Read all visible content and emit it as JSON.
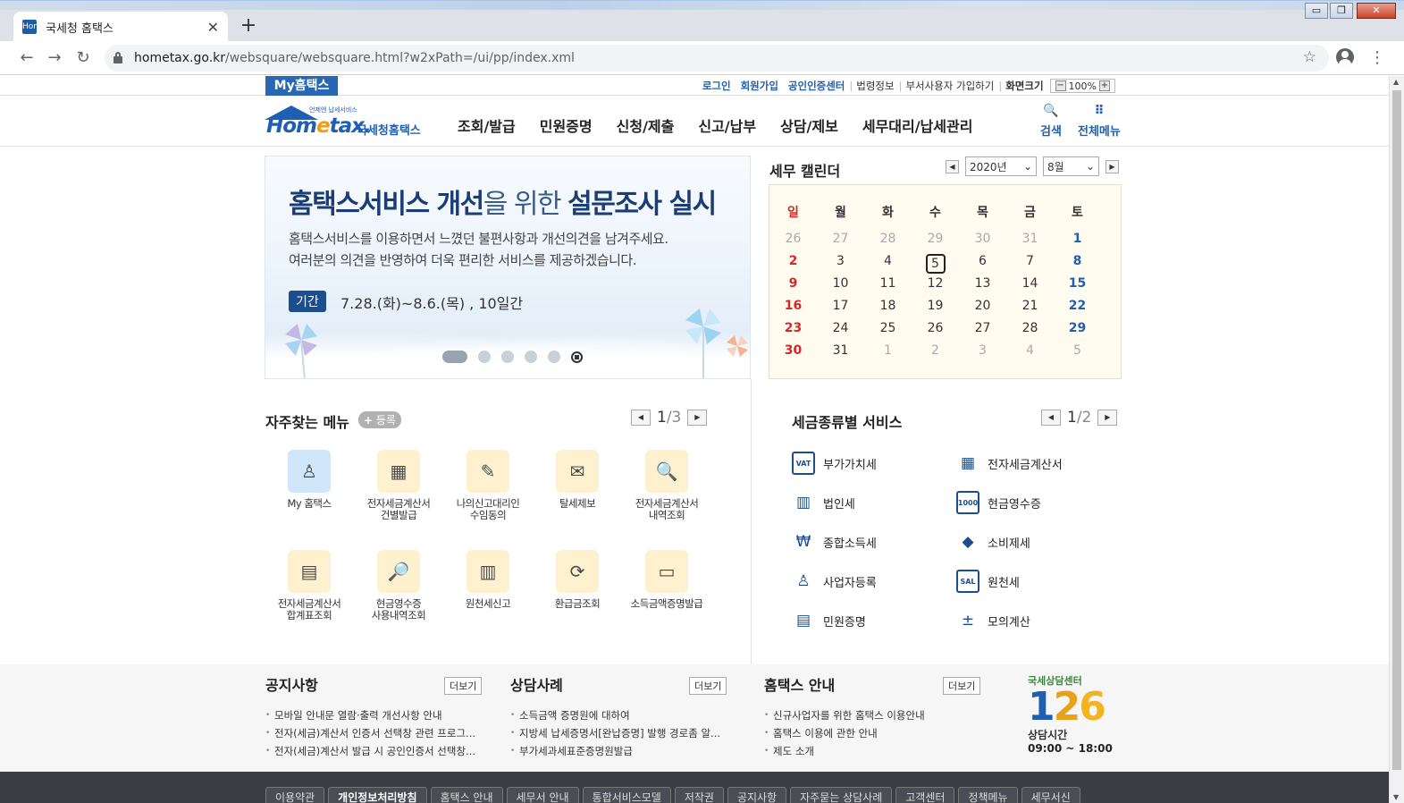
{
  "browser": {
    "tab_title": "국세청 홈택스",
    "tab_favicon": "Hom",
    "url_domain": "hometax.go.kr",
    "url_path": "/websquare/websquare.html?w2xPath=/ui/pp/index.xml",
    "win_min": "▭",
    "win_max": "❐",
    "win_close": "✕"
  },
  "util": {
    "my_hometax": "My홈택스",
    "login": "로그인",
    "signup": "회원가입",
    "cert_center": "공인인증센터",
    "law_info": "법령정보",
    "dept_user": "부서사용자 가입하기",
    "screen_size": "화면크기",
    "zoom_level": "100%",
    "zoom_minus": "−",
    "zoom_plus": "+"
  },
  "header": {
    "logo_brand_a": "Hom",
    "logo_brand_e": "e",
    "logo_brand_b": "tax.",
    "logo_kor": "국세청홈택스",
    "logo_sub": "언제엔 납세서비스",
    "gnb": [
      "조회/발급",
      "민원증명",
      "신청/제출",
      "신고/납부",
      "상담/제보",
      "세무대리/납세관리"
    ],
    "search_label": "검색",
    "allmenu_label": "전체메뉴"
  },
  "banner": {
    "title_a": "홈택스서비스 개선",
    "title_b": "을 위한 ",
    "title_c": "설문조사 실시",
    "desc_1": "홈택스서비스를 이용하면서 느꼈던 불편사항과 개선의견을 남겨주세요.",
    "desc_2": "여러분의 의견을 반영하여 더욱 편리한 서비스를 제공하겠습니다.",
    "badge": "기간",
    "period": "7.28.(화)~8.6.(목) , 10일간"
  },
  "calendar": {
    "title": "세무 캘린더",
    "year": "2020년",
    "month": "8월",
    "weekdays": [
      "일",
      "월",
      "화",
      "수",
      "목",
      "금",
      "토"
    ],
    "weeks": [
      [
        "26",
        "27",
        "28",
        "29",
        "30",
        "31",
        "1"
      ],
      [
        "2",
        "3",
        "4",
        "5",
        "6",
        "7",
        "8"
      ],
      [
        "9",
        "10",
        "11",
        "12",
        "13",
        "14",
        "15"
      ],
      [
        "16",
        "17",
        "18",
        "19",
        "20",
        "21",
        "22"
      ],
      [
        "23",
        "24",
        "25",
        "26",
        "27",
        "28",
        "29"
      ],
      [
        "30",
        "31",
        "1",
        "2",
        "3",
        "4",
        "5"
      ]
    ],
    "today": "5"
  },
  "frequent": {
    "title": "자주찾는 메뉴",
    "register": "등록",
    "page_current": "1",
    "page_total": "/3",
    "items": [
      {
        "label": "My 홈택스",
        "icon": "person-icon"
      },
      {
        "label": "전자세금계산서\n건별발급",
        "icon": "calculator-doc-icon"
      },
      {
        "label": "나의신고대리인\n수임동의",
        "icon": "pen-doc-icon"
      },
      {
        "label": "탈세제보",
        "icon": "tax-bag-icon"
      },
      {
        "label": "전자세금계산서\n내역조회",
        "icon": "doc-search-icon"
      },
      {
        "label": "전자세금계산서\n합계표조회",
        "icon": "doc-sum-icon"
      },
      {
        "label": "현금영수증\n사용내역조회",
        "icon": "receipt-search-icon"
      },
      {
        "label": "원천세신고",
        "icon": "calendar-pen-icon"
      },
      {
        "label": "환급금조회",
        "icon": "refund-icon"
      },
      {
        "label": "소득금액증명발급",
        "icon": "printer-icon"
      }
    ]
  },
  "taxservice": {
    "title": "세금종류별 서비스",
    "page_current": "1",
    "page_total": "/2",
    "items": [
      {
        "label": "부가가치세",
        "icon": "vat-icon",
        "glyph": "VAT"
      },
      {
        "label": "전자세금계산서",
        "icon": "calculator-icon",
        "glyph": "▦"
      },
      {
        "label": "법인세",
        "icon": "building-icon",
        "glyph": "▥"
      },
      {
        "label": "현금영수증",
        "icon": "cash-receipt-icon",
        "glyph": "1000"
      },
      {
        "label": "종합소득세",
        "icon": "money-bag-icon",
        "glyph": "₩"
      },
      {
        "label": "소비제세",
        "icon": "diamond-icon",
        "glyph": "◆"
      },
      {
        "label": "사업자등록",
        "icon": "person-icon",
        "glyph": "♙"
      },
      {
        "label": "원천세",
        "icon": "salary-icon",
        "glyph": "SAL"
      },
      {
        "label": "민원증명",
        "icon": "document-icon",
        "glyph": "▤"
      },
      {
        "label": "모의계산",
        "icon": "calc-icon",
        "glyph": "±"
      }
    ]
  },
  "notices": [
    {
      "title": "공지사항",
      "more": "더보기",
      "items": [
        "모바일 안내문 열람·출력 개선사항 안내",
        "전자(세금)계산서 인증서 선택창 관련 프로그...",
        "전자(세금)계산서 발급 시 공인인증서 선택창..."
      ]
    },
    {
      "title": "상담사례",
      "more": "더보기",
      "items": [
        "소득금액 증명원에 대하여",
        "지방세 납세증명서[완납증명] 발행 경로좀 알...",
        "부가세과세표준증명원발급"
      ]
    },
    {
      "title": "홈택스 안내",
      "more": "더보기",
      "items": [
        "신규사업자를 위한 홈택스 이용안내",
        "홈택스 이용에 관한 안내",
        "제도 소개"
      ]
    }
  ],
  "callcenter": {
    "label": "국세상담센터",
    "d1": "1",
    "d2": "2",
    "d3": "6",
    "hours_label": "상담시간",
    "hours": "09:00 ~ 18:00"
  },
  "footer": {
    "links": [
      "이용약관",
      "개인정보처리방침",
      "홈택스 안내",
      "세무서 안내",
      "통합서비스모델",
      "저작권",
      "공지사항",
      "자주묻는 상담사례",
      "고객센터",
      "정책메뉴",
      "세무서신"
    ]
  }
}
